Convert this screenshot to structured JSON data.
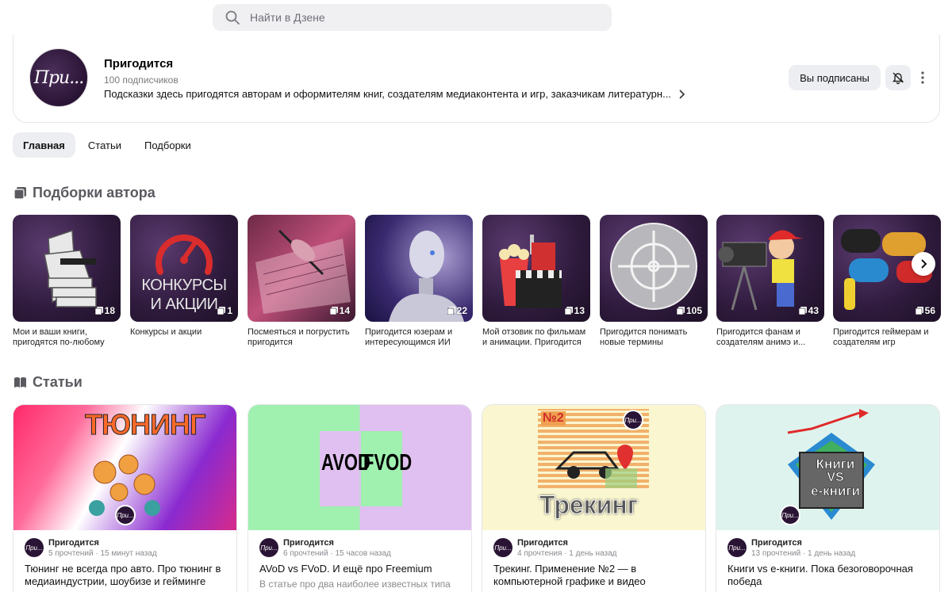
{
  "search": {
    "placeholder": "Найти в Дзене"
  },
  "channel": {
    "avatar_text": "При...",
    "title": "Пригодится",
    "subscribers": "100 подписчиков",
    "description": "Подсказки здесь пригодятся авторам и оформителям книг, создателям медиаконтента и игр, заказчикам литературн...",
    "subscribed_label": "Вы подписаны"
  },
  "tabs": [
    {
      "label": "Главная",
      "active": true
    },
    {
      "label": "Статьи",
      "active": false
    },
    {
      "label": "Подборки",
      "active": false
    }
  ],
  "collections_section": {
    "title": "Подборки автора",
    "items": [
      {
        "caption": "Мои и ваши книги, пригодятся по-любому",
        "count": "18",
        "thumb_icon": "books-stack-icon"
      },
      {
        "caption": "Конкурсы и акции",
        "count": "1",
        "thumb_text_1": "КОНКУРСЫ",
        "thumb_text_2": "И АКЦИИ",
        "thumb_icon": "speedometer-icon"
      },
      {
        "caption": "Посмеяться и погрустить пригодится",
        "count": "14",
        "thumb_icon": "writing-hand-icon"
      },
      {
        "caption": "Пригодится юзерам и интересующимся ИИ",
        "count": "22",
        "thumb_icon": "robot-icon"
      },
      {
        "caption": "Мой отзовик по фильмам и анимации. Пригодится",
        "count": "13",
        "thumb_icon": "popcorn-clapper-icon"
      },
      {
        "caption": "Пригодится понимать новые термины",
        "count": "105",
        "thumb_icon": "crosshair-icon"
      },
      {
        "caption": "Пригодится фанам и создателям анимэ и...",
        "count": "43",
        "thumb_icon": "cameraman-icon"
      },
      {
        "caption": "Пригодится геймерам и создателям игр",
        "count": "56",
        "thumb_icon": "gamepads-icon"
      }
    ]
  },
  "articles_section": {
    "title": "Статьи",
    "items": [
      {
        "author": "Пригодится",
        "stats": "5 прочтений · 15 минут назад",
        "title": "Тюнинг не всегда про авто. Про тюнинг в медиаиндустрии, шоубизе и гейминге",
        "subtitle": "",
        "img_text": "ТЮНИНГ",
        "badge": "При..."
      },
      {
        "author": "Пригодится",
        "stats": "6 прочтений · 15 часов назад",
        "title": "AVoD vs FVoD. И ещё про Freemium",
        "subtitle": "В статье про два наиболее известных типа",
        "img_text_left": "AVOD",
        "img_text_right": "FVOD"
      },
      {
        "author": "Пригодится",
        "stats": "4 прочтения · 1 день назад",
        "title": "Трекинг. Применение №2 — в компьютерной графике и видео",
        "subtitle": "",
        "img_text": "Трекинг",
        "img_number": "№2",
        "badge": "При..."
      },
      {
        "author": "Пригодится",
        "stats": "13 прочтений · 1 день назад",
        "title": "Книги vs e-книги. Пока безоговорочная победа",
        "subtitle": "",
        "img_text_1": "Книги",
        "img_text_2": "VS",
        "img_text_3": "е-книги",
        "badge": "При..."
      }
    ]
  },
  "mini_avatar_text": "При...",
  "colors": {
    "accent_purple": "#2a1435",
    "button_bg": "#eceef1",
    "muted_text": "#7a7a80"
  }
}
